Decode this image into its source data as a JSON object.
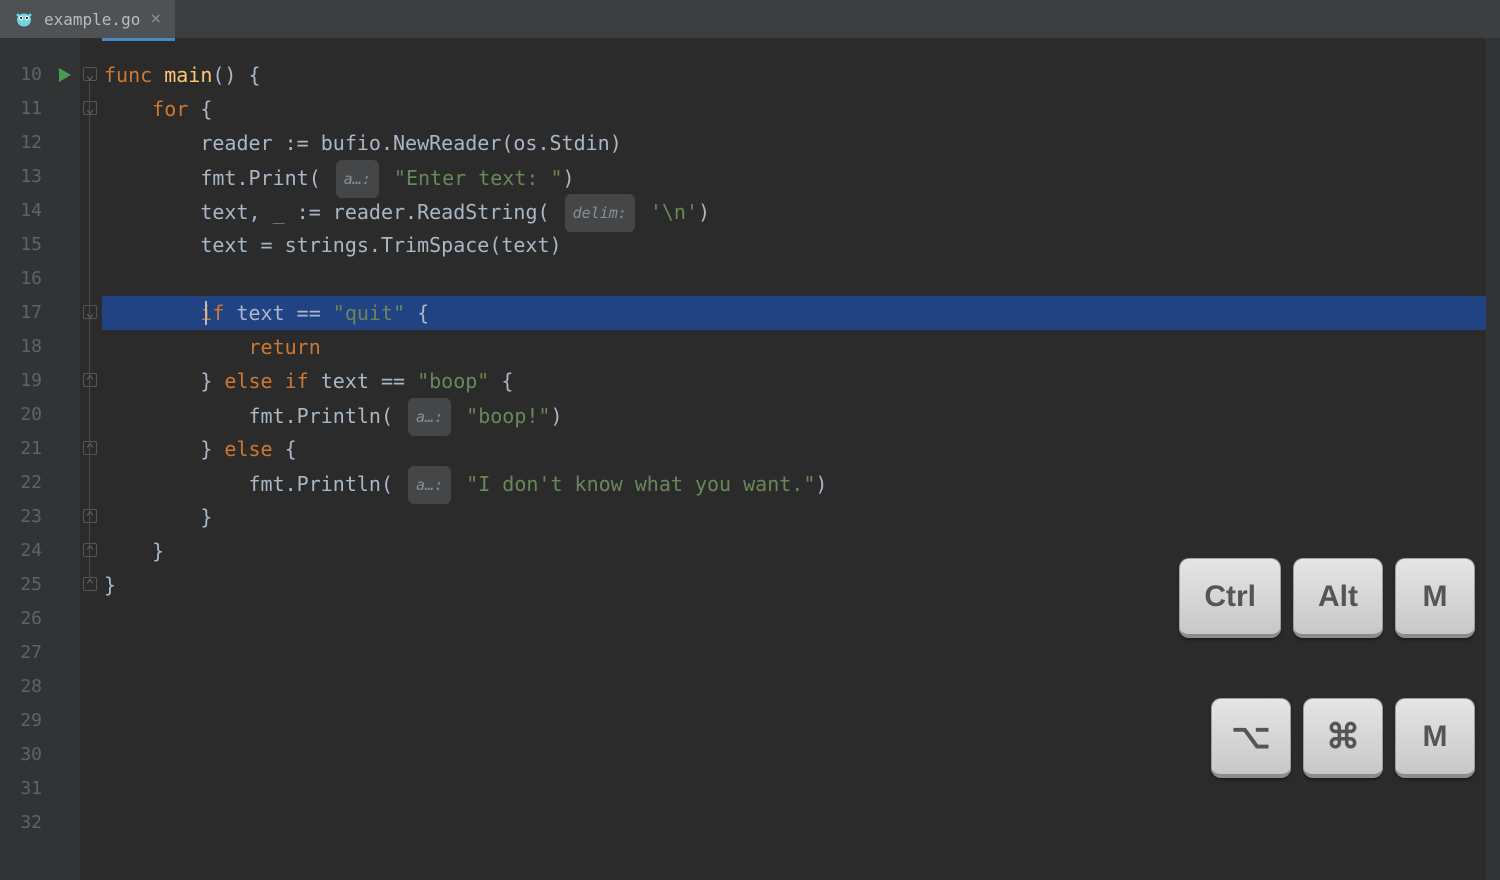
{
  "tab": {
    "filename": "example.go",
    "close_glyph": "×"
  },
  "gutter": {
    "start": 10,
    "end": 32
  },
  "highlighted_line": 17,
  "hints": {
    "a_ellipsis": "a…:",
    "delim": "delim:"
  },
  "code": {
    "l10": {
      "kw": "func",
      "fn": "main",
      "rest": "() {"
    },
    "l11": {
      "kw": "for",
      "rest": " {"
    },
    "l12": {
      "t": "reader := bufio.NewReader(os.Stdin)",
      "parts": [
        "reader ",
        ":=",
        " bufio.",
        "NewReader",
        "(os.Stdin)"
      ]
    },
    "l13": {
      "pre": "fmt.Print( ",
      "str": "\"Enter text: \"",
      "post": ")"
    },
    "l14": {
      "pre": "text, ",
      "blank": "_",
      "mid": " := reader.ReadString( ",
      "str": "'\\n'",
      "post": ")"
    },
    "l15": {
      "t": "text = strings.TrimSpace(text)"
    },
    "l17": {
      "kw": "if",
      "mid": " text == ",
      "str": "\"quit\"",
      "post": " {"
    },
    "l18": {
      "kw": "return"
    },
    "l19": {
      "pre": "} ",
      "kw1": "else",
      "kw2": " if",
      "mid": " text == ",
      "str": "\"boop\"",
      "post": " {"
    },
    "l20": {
      "pre": "fmt.Println( ",
      "str": "\"boop!\"",
      "post": ")"
    },
    "l21": {
      "pre": "} ",
      "kw": "else",
      "post": " {"
    },
    "l22": {
      "pre": "fmt.Println( ",
      "str": "\"I don't know what you want.\"",
      "post": ")"
    },
    "l23": {
      "t": "}"
    },
    "l24": {
      "t": "}"
    },
    "l25": {
      "t": "}"
    }
  },
  "keycaps": {
    "row1": [
      "Ctrl",
      "Alt",
      "M"
    ],
    "row2_icons": [
      "⌥",
      "⌘"
    ],
    "row2_text": "M"
  },
  "fold_down_glyph": "⌄",
  "fold_up_glyph": "⌃"
}
